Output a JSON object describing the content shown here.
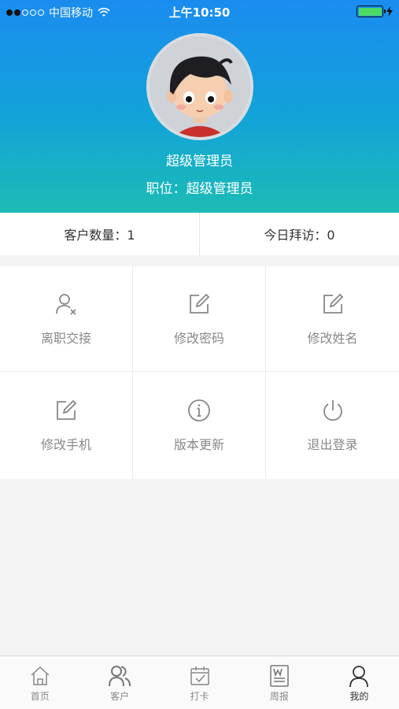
{
  "status_bar": {
    "carrier": "中国移动",
    "time": "上午10:50",
    "battery_color": "#4cd964"
  },
  "profile": {
    "name": "超级管理员",
    "position_line": "职位：超级管理员",
    "avatar_icon": "cartoon-boy-avatar"
  },
  "stats": {
    "customer_count": "客户数量：1",
    "today_visits": "今日拜访：0"
  },
  "menu": {
    "items": [
      {
        "label": "离职交接",
        "icon": "user-remove-icon"
      },
      {
        "label": "修改密码",
        "icon": "edit-icon"
      },
      {
        "label": "修改姓名",
        "icon": "edit-icon"
      },
      {
        "label": "修改手机",
        "icon": "edit-icon"
      },
      {
        "label": "版本更新",
        "icon": "info-icon"
      },
      {
        "label": "退出登录",
        "icon": "power-icon"
      }
    ]
  },
  "tabbar": {
    "items": [
      {
        "label": "首页",
        "icon": "home-icon",
        "active": false
      },
      {
        "label": "客户",
        "icon": "users-icon",
        "active": false
      },
      {
        "label": "打卡",
        "icon": "calendar-check-icon",
        "active": false
      },
      {
        "label": "周报",
        "icon": "weekly-report-icon",
        "active": false
      },
      {
        "label": "我的",
        "icon": "user-icon",
        "active": true
      }
    ]
  },
  "colors": {
    "header_gradient_top": "#1a8cf0",
    "header_gradient_bottom": "#1cbcb5",
    "background": "#f4f4f4"
  }
}
